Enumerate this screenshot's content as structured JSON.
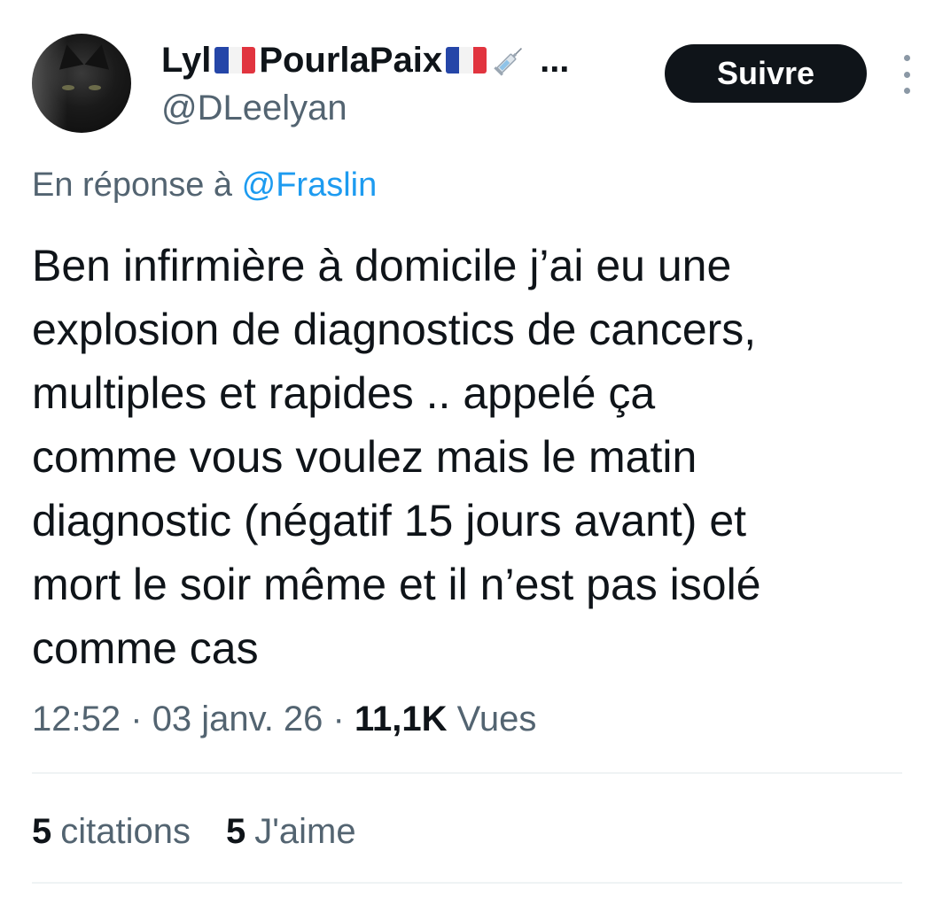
{
  "author": {
    "display_name_start": "Lyl",
    "display_name_middle": "PourlaPaix",
    "display_name_ellipsis": "...",
    "handle": "@DLeelyan",
    "flag_icon": "french-flag",
    "syringe_icon": "syringe"
  },
  "follow_button": {
    "label": "Suivre"
  },
  "reply": {
    "prefix": "En réponse à",
    "mention": "@Fraslin"
  },
  "tweet": {
    "lines": [
      "Ben infirmière à domicile j’ai eu une",
      "explosion de diagnostics de cancers,",
      "multiples et rapides .. appelé ça",
      "comme vous voulez mais le matin",
      "diagnostic (négatif 15 jours avant) et",
      "mort le soir même et il n’est pas isolé",
      "comme cas"
    ]
  },
  "meta": {
    "time": "12:52",
    "separator": "·",
    "date": "03 janv. 26",
    "views_count": "11,1K",
    "views_label": "Vues"
  },
  "stats": {
    "quotes_count": "5",
    "quotes_label": "citations",
    "likes_count": "5",
    "likes_label": "J'aime"
  },
  "colors": {
    "text": "#0f1419",
    "secondary": "#536471",
    "link": "#1d9bf0",
    "button_bg": "#0f1419",
    "divider": "#eff3f4"
  }
}
